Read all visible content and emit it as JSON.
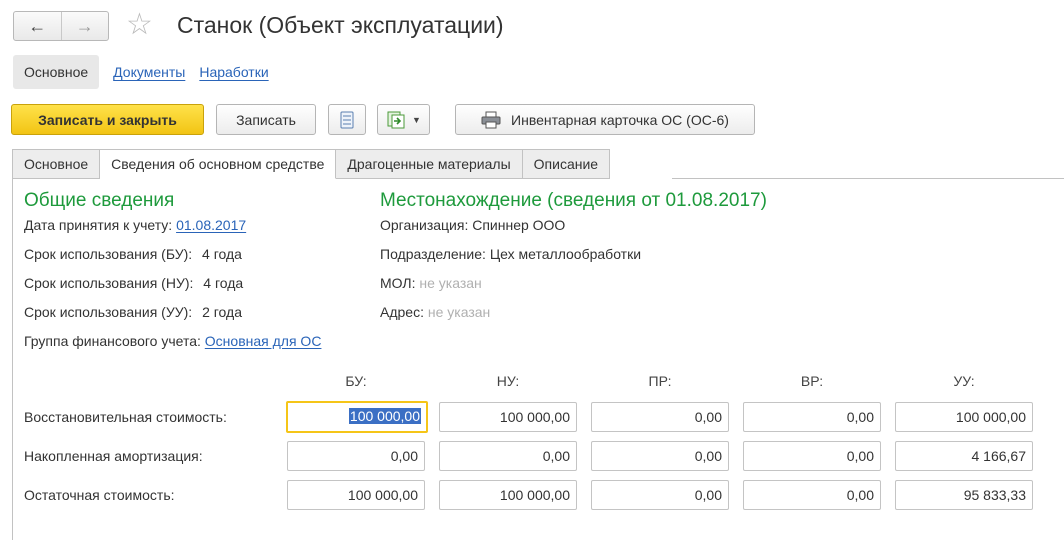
{
  "window": {
    "title": "Станок (Объект эксплуатации)",
    "nav_back_icon": "arrow-left-icon",
    "nav_forward_icon": "arrow-right-icon",
    "favorite_icon": "star-icon"
  },
  "sections": {
    "main": "Основное",
    "documents": "Документы",
    "operating_time": "Наработки"
  },
  "toolbar": {
    "save_close": "Записать и закрыть",
    "save": "Записать",
    "list_icon": "list-icon",
    "generate_icon": "create-based-on-icon",
    "print_icon": "printer-icon",
    "print_label": "Инвентарная карточка ОС (ОС-6)"
  },
  "tabs": [
    "Основное",
    "Сведения об основном средстве",
    "Драгоценные материалы",
    "Описание"
  ],
  "general": {
    "heading": "Общие сведения",
    "accept_date_label": "Дата принятия к учету:",
    "accept_date_value": "01.08.2017",
    "term_bu_label": "Срок использования (БУ):",
    "term_bu_value": "4 года",
    "term_nu_label": "Срок использования (НУ):",
    "term_nu_value": "4 года",
    "term_uu_label": "Срок использования (УУ):",
    "term_uu_value": "2 года",
    "fin_group_label": "Группа финансового учета:",
    "fin_group_value": "Основная для ОС"
  },
  "location": {
    "heading": "Местонахождение (сведения от 01.08.2017)",
    "org_label": "Организация:",
    "org_value": "Спиннер ООО",
    "dept_label": "Подразделение:",
    "dept_value": "Цех металлообработки",
    "mol_label": "МОЛ:",
    "mol_value": "не указан",
    "address_label": "Адрес:",
    "address_value": "не указан"
  },
  "values_table": {
    "columns": [
      "БУ:",
      "НУ:",
      "ПР:",
      "ВР:",
      "УУ:"
    ],
    "rows": [
      {
        "label": "Восстановительная стоимость:",
        "values": [
          "100 000,00",
          "100 000,00",
          "0,00",
          "0,00",
          "100 000,00"
        ]
      },
      {
        "label": "Накопленная амортизация:",
        "values": [
          "0,00",
          "0,00",
          "0,00",
          "0,00",
          "4 166,67"
        ]
      },
      {
        "label": "Остаточная стоимость:",
        "values": [
          "100 000,00",
          "100 000,00",
          "0,00",
          "0,00",
          "95 833,33"
        ]
      }
    ]
  }
}
